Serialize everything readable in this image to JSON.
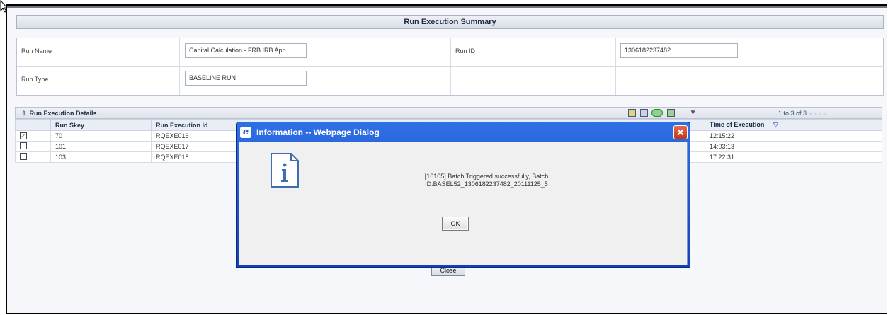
{
  "summary": {
    "title": "Run Execution Summary",
    "run_name_label": "Run Name",
    "run_name_value": "Capital Calculation - FRB IRB App",
    "run_id_label": "Run ID",
    "run_id_value": "1306182237482",
    "run_type_label": "Run Type",
    "run_type_value": "BASELINE RUN"
  },
  "details": {
    "title": "Run Execution Details",
    "pager": "1 to 3 of 3",
    "columns": [
      "Run Skey",
      "Run Execution Id",
      "Time of Execution"
    ],
    "rows": [
      {
        "checked": "✓",
        "skey": "70",
        "exec_id": "RQEXE016",
        "time": "12:15:22"
      },
      {
        "checked": "",
        "skey": "101",
        "exec_id": "RQEXE017",
        "time": "14:03:13"
      },
      {
        "checked": "",
        "skey": "103",
        "exec_id": "RQEXE018",
        "time": "17:22:31"
      }
    ]
  },
  "close_label": "Close",
  "dialog": {
    "title": "Information -- Webpage Dialog",
    "message_line1": "[16105] Batch Triggered successfully, Batch",
    "message_line2": "ID:BASEL52_1306182237482_20111125_5",
    "ok_label": "OK"
  },
  "colors": {
    "dialog_title_bar": "#1e58d0",
    "close_button": "#c2361a",
    "page_background": "#f5f7fb"
  },
  "icons": [
    "cursor-arrow",
    "ie-icon",
    "close-x",
    "info-icon",
    "filter-icon",
    "chart-icon",
    "export-icon",
    "settings-icon"
  ]
}
